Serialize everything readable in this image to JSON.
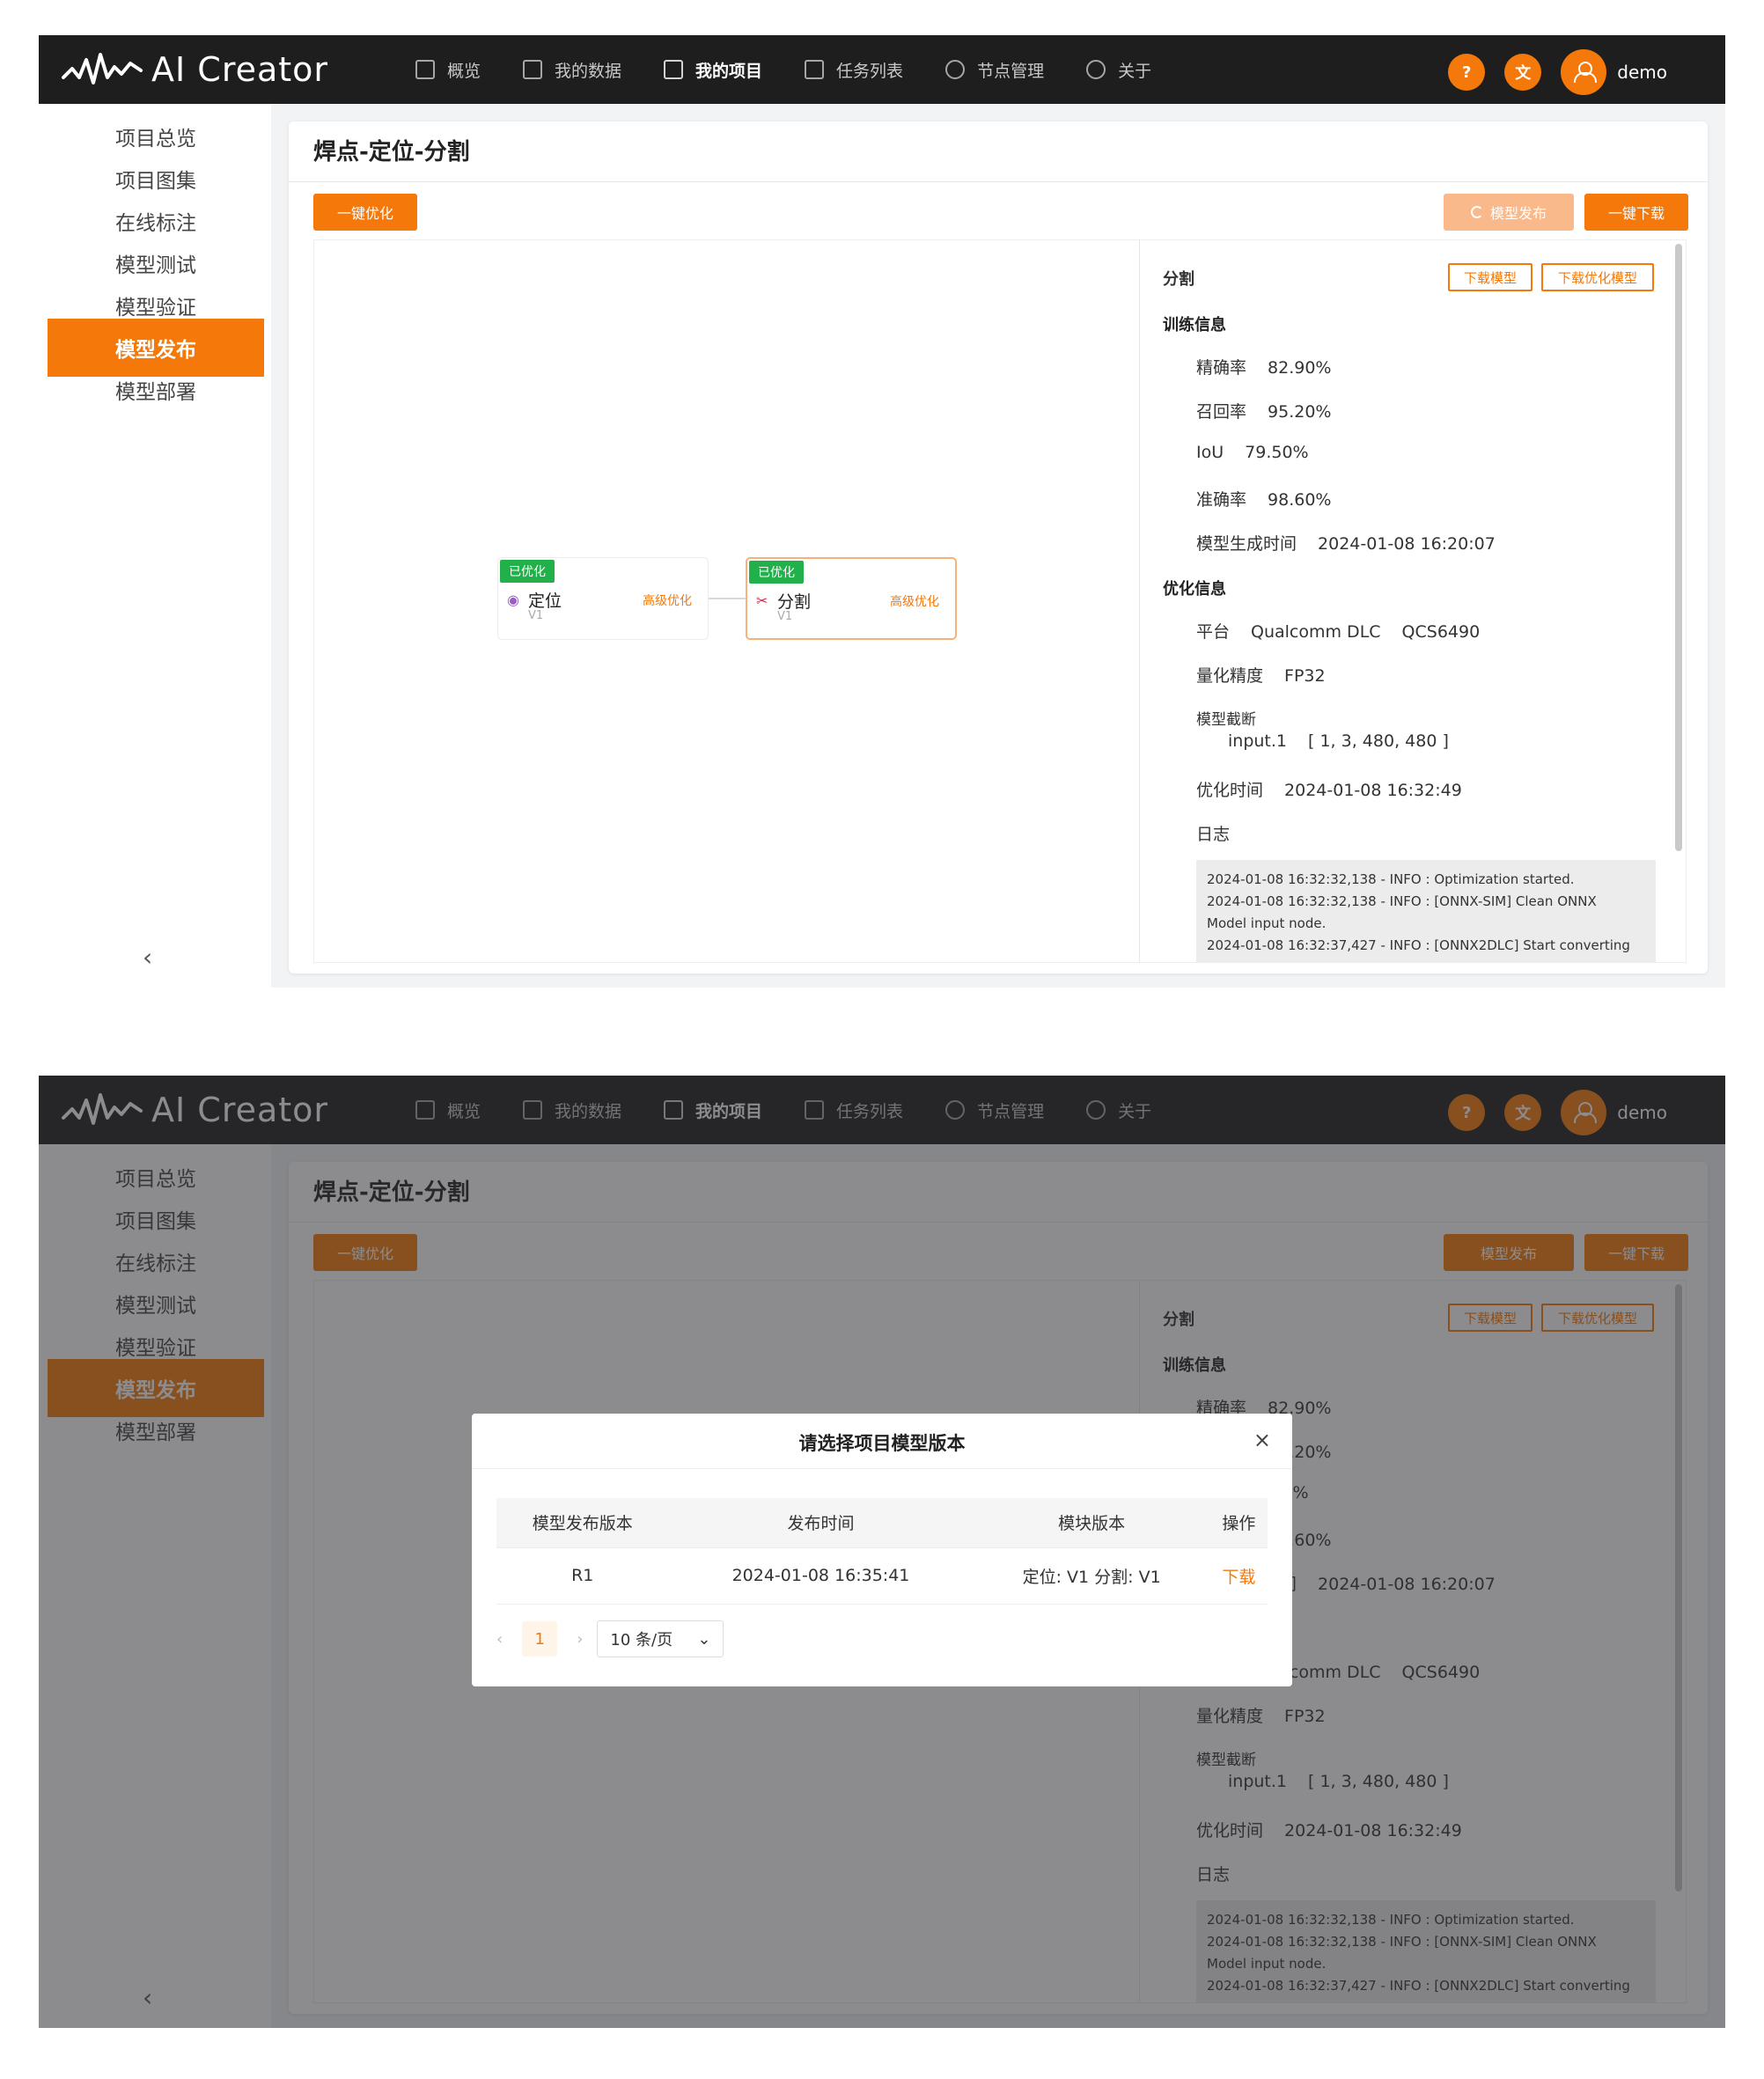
{
  "brand": {
    "title": "AI Creator"
  },
  "nav": [
    {
      "label": "概览",
      "icon": "grid-icon"
    },
    {
      "label": "我的数据",
      "icon": "database-icon"
    },
    {
      "label": "我的项目",
      "icon": "folder-icon",
      "active": true
    },
    {
      "label": "任务列表",
      "icon": "list-icon"
    },
    {
      "label": "节点管理",
      "icon": "node-icon"
    },
    {
      "label": "关于",
      "icon": "info-icon"
    }
  ],
  "user": {
    "name": "demo",
    "help_glyph": "?",
    "lang_glyph": "文"
  },
  "sidebar": {
    "items": [
      {
        "label": "项目总览"
      },
      {
        "label": "项目图集"
      },
      {
        "label": "在线标注"
      },
      {
        "label": "模型测试"
      },
      {
        "label": "模型验证"
      },
      {
        "label": "模型发布",
        "active": true
      },
      {
        "label": "模型部署"
      }
    ],
    "collapse": "‹"
  },
  "page": {
    "title": "焊点-定位-分割",
    "optimize_button": "一键优化",
    "publish_button": "模型发布",
    "download_all_button": "一键下载"
  },
  "flow": {
    "nodes": [
      {
        "tag": "已优化",
        "name": "定位",
        "version": "V1",
        "action": "高级优化"
      },
      {
        "tag": "已优化",
        "name": "分割",
        "version": "V1",
        "action": "高级优化"
      }
    ]
  },
  "info": {
    "name": "分割",
    "download_model": "下载模型",
    "download_opt_model": "下载优化模型",
    "training_title": "训练信息",
    "training": [
      {
        "k": "精确率",
        "v": "82.90%"
      },
      {
        "k": "召回率",
        "v": "95.20%"
      },
      {
        "k": "IoU",
        "v": "79.50%"
      },
      {
        "k": "准确率",
        "v": "98.60%"
      },
      {
        "k": "模型生成时间",
        "v": "2024-01-08 16:20:07"
      }
    ],
    "opt_title": "优化信息",
    "platform_k": "平台",
    "platform_v": "Qualcomm DLC",
    "platform_chip": "QCS6490",
    "precision_k": "量化精度",
    "precision_v": "FP32",
    "truncate_k": "模型截断",
    "truncate_input": "input.1",
    "truncate_shape": "[ 1, 3, 480, 480 ]",
    "opt_time_k": "优化时间",
    "opt_time_v": "2024-01-08 16:32:49",
    "log_k": "日志",
    "logs": [
      "2024-01-08 16:32:32,138 - INFO : Optimization started.",
      "2024-01-08 16:32:32,138 - INFO : [ONNX-SIM] Clean ONNX",
      "Model input node.",
      "2024-01-08 16:32:37,427 - INFO : [ONNX2DLC] Start converting"
    ]
  },
  "modal": {
    "title": "请选择项目模型版本",
    "close": "×",
    "columns": [
      "模型发布版本",
      "发布时间",
      "模块版本",
      "操作"
    ],
    "rows": [
      {
        "version": "R1",
        "time": "2024-01-08 16:35:41",
        "modules": "定位: V1    分割: V1",
        "action": "下载"
      }
    ],
    "pager": {
      "prev": "‹",
      "page": "1",
      "next": "›",
      "size": "10 条/页",
      "arrow": "⌄"
    }
  },
  "colors": {
    "accent": "#f5780a",
    "topbar": "#1e1e1e",
    "success": "#22b04b"
  }
}
